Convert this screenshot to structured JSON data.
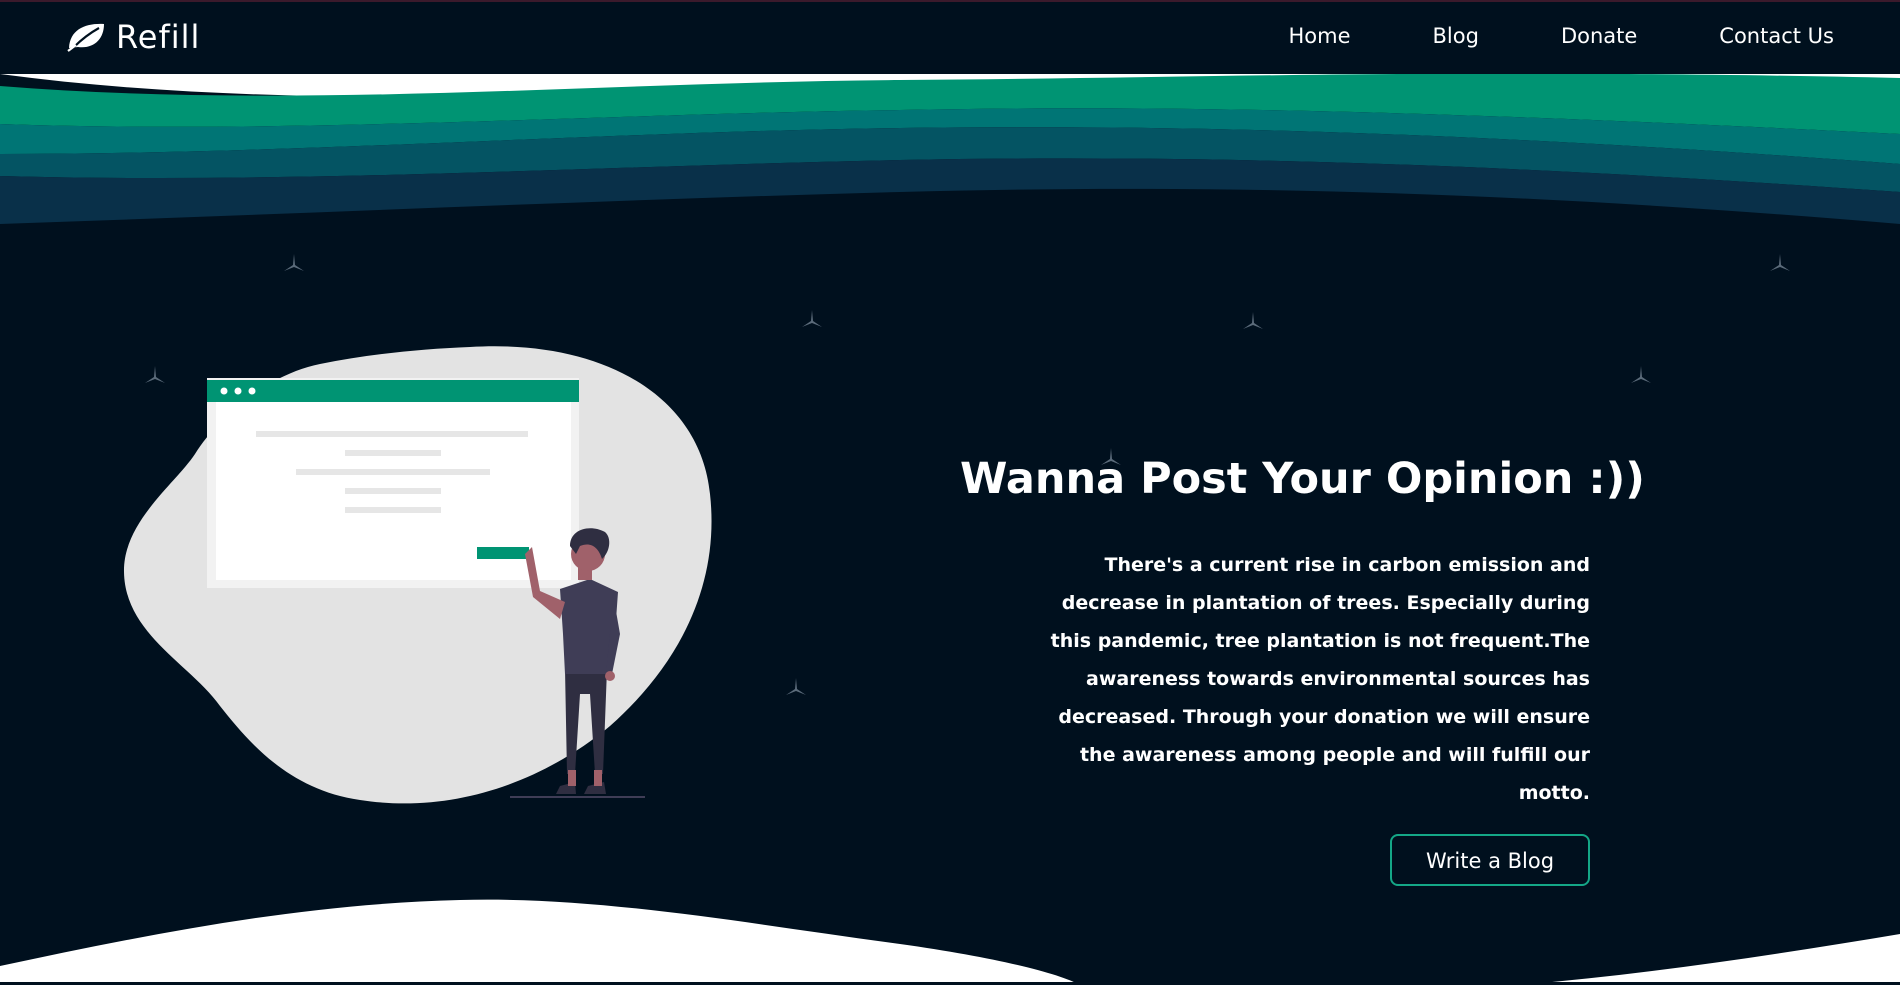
{
  "navbar": {
    "brand": "Refill",
    "links": [
      {
        "label": "Home"
      },
      {
        "label": "Blog"
      },
      {
        "label": "Donate"
      },
      {
        "label": "Contact Us"
      }
    ]
  },
  "hero": {
    "title": "Wanna Post Your Opinion :))",
    "text": "There's a current rise in carbon emission and decrease in plantation of trees. Especially during this pandemic, tree plantation is not frequent.The awareness towards environmental sources has decreased. Through your donation we will ensure the awareness among people and will fulfill our motto.",
    "button_label": "Write a Blog"
  },
  "colors": {
    "background_dark": "#00101e",
    "accent_green": "#14a787",
    "wave_green": "#009473",
    "wave_teal": "#007575",
    "wave_dark_teal": "#045463",
    "wave_navy": "#093049",
    "blob_gray": "#e3e3e3"
  },
  "icons": {
    "brand": "leaf-icon",
    "stars": "star-sparkle-icon"
  }
}
